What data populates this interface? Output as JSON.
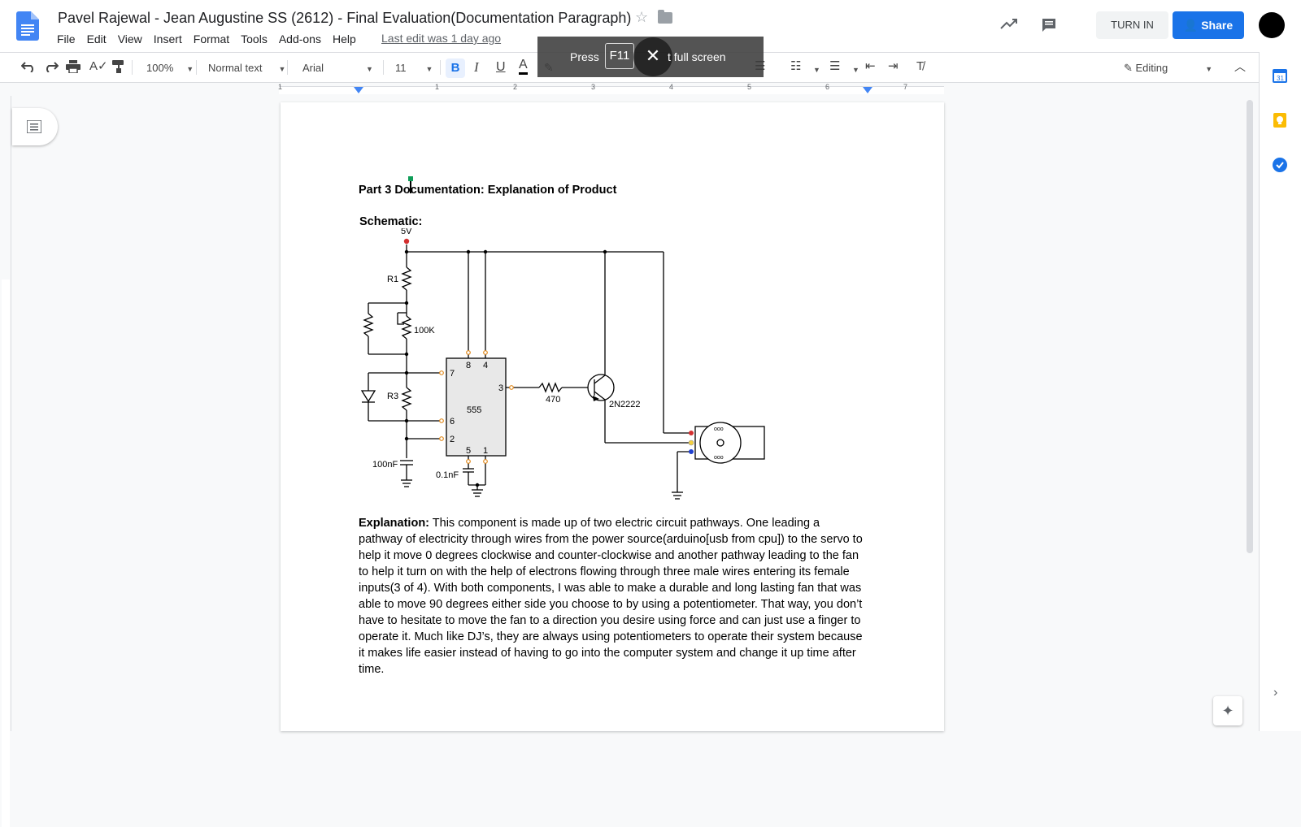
{
  "doc": {
    "title": "Pavel Rajewal - Jean Augustine SS (2612) - Final Evaluation(Documentation Paragraph)",
    "last_edit": "Last edit was 1 day ago"
  },
  "menu": [
    "File",
    "Edit",
    "View",
    "Insert",
    "Format",
    "Tools",
    "Add-ons",
    "Help"
  ],
  "header": {
    "turn_in": "TURN IN",
    "share": "Share"
  },
  "toolbar": {
    "zoom": "100%",
    "style": "Normal text",
    "font": "Arial",
    "size": "11",
    "bold": "B",
    "italic": "I",
    "underline": "U",
    "text_color": "A",
    "mode": "Editing"
  },
  "banner": {
    "press": "Press",
    "key": "F11",
    "exit": "t full screen"
  },
  "ruler_marks": [
    "1",
    "1",
    "2",
    "3",
    "4",
    "5",
    "6",
    "7"
  ],
  "document": {
    "heading": "Part 3 Documentation: Explanation of Product",
    "schematic_label": "Schematic:",
    "explanation_label": "Explanation:",
    "explanation_text": " This component is made up of two electric circuit pathways. One leading a pathway of electricity through wires from the power source(arduino[usb from cpu]) to the servo to help it move 0 degrees clockwise and counter-clockwise and another pathway leading to the fan to help it turn on with the help of electrons flowing through three male wires entering its female inputs(3 of 4). With both components, I was able to make a durable and long lasting fan that was able to move 90 degrees either side you choose to by using a potentiometer. That way, you don’t have to hesitate to move the fan to a direction you desire using force and can just use a finger to operate it. Much like DJ’s, they are always using potentiometers to operate their system because it makes life easier instead of having to go into the computer system and change it up time after time."
  },
  "circuit": {
    "v5": "5V",
    "r1": "R1",
    "pot": "100K",
    "r3": "R3",
    "c1": "100nF",
    "c2": "0.1nF",
    "ic": "555",
    "pin8": "8",
    "pin4": "4",
    "pin7": "7",
    "pin3": "3",
    "pin6": "6",
    "pin2": "2",
    "pin5": "5",
    "pin1": "1",
    "r470": "470",
    "transistor": "2N2222",
    "motor_dots": "ooo"
  },
  "colors": {
    "accent": "#1a73e8",
    "docs_blue": "#4285f4"
  }
}
